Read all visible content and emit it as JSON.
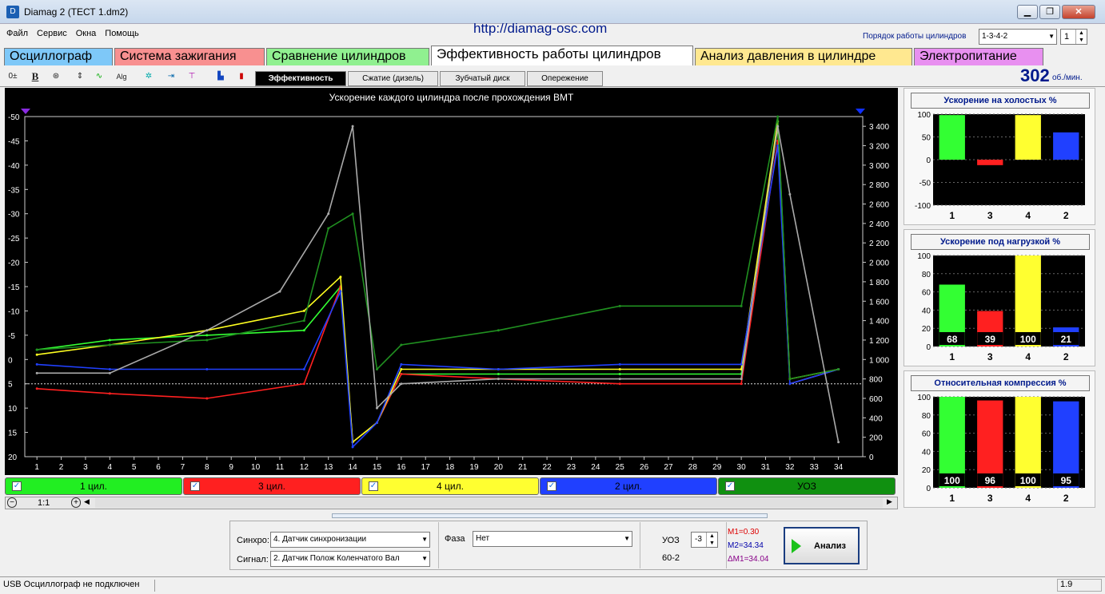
{
  "window": {
    "title": "Diamag 2 (ТЕСТ 1.dm2)",
    "url": "http://diamag-osc.com"
  },
  "menu": [
    "Файл",
    "Сервис",
    "Окна",
    "Помощь"
  ],
  "firing_order": {
    "label": "Порядок работы цилиндров",
    "value": "1-3-4-2",
    "spin": "1"
  },
  "tabs": [
    {
      "label": "Осциллограф",
      "color": "#7ec8f8"
    },
    {
      "label": "Система зажигания",
      "color": "#f89090"
    },
    {
      "label": "Сравнение цилиндров",
      "color": "#90f090"
    },
    {
      "label": "Эффективность работы цилиндров",
      "color": "#ffffff",
      "active": true
    },
    {
      "label": "Анализ давления в цилиндре",
      "color": "#ffe890"
    },
    {
      "label": "Электропитание",
      "color": "#e890f0"
    }
  ],
  "subtabs": [
    {
      "label": "Эффективность",
      "active": true
    },
    {
      "label": "Сжатие (дизель)"
    },
    {
      "label": "Зубчатый диск"
    },
    {
      "label": "Опережение"
    }
  ],
  "rpm": {
    "value": "302",
    "unit": "об./мин."
  },
  "chart_data": {
    "type": "line",
    "title": "Ускорение каждого цилиндра после прохождения ВМТ",
    "x_ticks": [
      "1",
      "2",
      "3",
      "4",
      "5",
      "6",
      "7",
      "8",
      "9",
      "10",
      "11",
      "12",
      "13",
      "14",
      "15",
      "16",
      "17",
      "18",
      "19",
      "20",
      "21",
      "22",
      "23",
      "24",
      "25",
      "26",
      "27",
      "28",
      "29",
      "30",
      "31",
      "32",
      "33",
      "34"
    ],
    "left_ticks": [
      "-50",
      "-45",
      "-40",
      "-35",
      "-30",
      "-25",
      "-20",
      "-15",
      "-10",
      "-5",
      "0",
      "5",
      "10",
      "15",
      "20"
    ],
    "right_ticks": [
      "3 400",
      "3 200",
      "3 000",
      "2 800",
      "2 600",
      "2 400",
      "2 200",
      "2 000",
      "1 800",
      "1 600",
      "1 400",
      "1 200",
      "1 000",
      "800",
      "600",
      "400",
      "200",
      "0"
    ],
    "ylim_left": [
      -50,
      20
    ],
    "ylim_right": [
      0,
      3500
    ],
    "series": [
      {
        "name": "1 цил.",
        "color": "#33ff33",
        "x": [
          1,
          4,
          8,
          12,
          13.5,
          14,
          15,
          16,
          20,
          25,
          30,
          31.5,
          32,
          34
        ],
        "y": [
          -2,
          -4,
          -5,
          -6,
          -15,
          17,
          13,
          3,
          3,
          3,
          3,
          -48,
          5,
          2
        ]
      },
      {
        "name": "3 цил.",
        "color": "#ff2020",
        "x": [
          1,
          4,
          8,
          12,
          13.5,
          14,
          15,
          16,
          20,
          25,
          30,
          31.5,
          32,
          34
        ],
        "y": [
          6,
          7,
          8,
          5,
          -15,
          17,
          13,
          3,
          4,
          5,
          5,
          -45,
          5,
          2
        ]
      },
      {
        "name": "4 цил.",
        "color": "#ffff20",
        "x": [
          1,
          4,
          8,
          12,
          13.5,
          14,
          15,
          16,
          20,
          25,
          30,
          31.5,
          32,
          34
        ],
        "y": [
          -1,
          -3,
          -6,
          -10,
          -17,
          17,
          13,
          2,
          2,
          2,
          2,
          -49,
          4,
          2
        ]
      },
      {
        "name": "2 цил.",
        "color": "#2040ff",
        "x": [
          1,
          4,
          8,
          12,
          13.5,
          14,
          15,
          16,
          20,
          25,
          30,
          31.5,
          32,
          34
        ],
        "y": [
          1,
          2,
          2,
          2,
          -14,
          18,
          13,
          1,
          2,
          1,
          1,
          -44,
          5,
          2
        ]
      },
      {
        "name": "УОЗ",
        "color": "#209020",
        "x": [
          1,
          4,
          8,
          12,
          13,
          14,
          15,
          16,
          20,
          25,
          30,
          31.5,
          32,
          34
        ],
        "y": [
          -2,
          -3,
          -4,
          -8,
          -27,
          -30,
          2,
          -3,
          -6,
          -11,
          -11,
          -50,
          4,
          2
        ]
      },
      {
        "name": "об./мин.",
        "color": "#aaaaaa",
        "axis": "right",
        "x": [
          1,
          4,
          8,
          11,
          13,
          14,
          15,
          16,
          20,
          25,
          30,
          31.5,
          32,
          34
        ],
        "y": [
          860,
          860,
          1300,
          1700,
          2500,
          3400,
          500,
          750,
          800,
          800,
          800,
          3400,
          2700,
          150
        ]
      }
    ]
  },
  "legend": [
    {
      "label": "1 цил.",
      "color": "#22ee22"
    },
    {
      "label": "3 цил.",
      "color": "#ff2020"
    },
    {
      "label": "4 цил.",
      "color": "#ffff30"
    },
    {
      "label": "2 цил.",
      "color": "#2040ff"
    },
    {
      "label": "УОЗ",
      "color": "#109010"
    }
  ],
  "zoom": {
    "ratio": "1:1"
  },
  "side_charts": [
    {
      "title": "Ускорение на холостых %",
      "yticks": [
        "100",
        "50",
        "0",
        "-50",
        "-100"
      ],
      "ymin": -100,
      "ymax": 100,
      "categories": [
        "1",
        "3",
        "4",
        "2"
      ],
      "values": [
        98,
        -12,
        98,
        60
      ],
      "labels": []
    },
    {
      "title": "Ускорение под нагрузкой %",
      "yticks": [
        "100",
        "80",
        "60",
        "40",
        "20",
        "0"
      ],
      "ymin": 0,
      "ymax": 100,
      "categories": [
        "1",
        "3",
        "4",
        "2"
      ],
      "values": [
        68,
        39,
        100,
        21
      ],
      "labels": [
        "68",
        "39",
        "100",
        "21"
      ]
    },
    {
      "title": "Относительная компрессия %",
      "yticks": [
        "100",
        "80",
        "60",
        "40",
        "20",
        "0"
      ],
      "ymin": 0,
      "ymax": 100,
      "categories": [
        "1",
        "3",
        "4",
        "2"
      ],
      "values": [
        100,
        96,
        100,
        95
      ],
      "labels": [
        "100",
        "96",
        "100",
        "95"
      ]
    }
  ],
  "bar_colors": [
    "#33ff33",
    "#ff2020",
    "#ffff30",
    "#2040ff"
  ],
  "bottom": {
    "sync_label": "Синхро:",
    "sync_value": "4.  Датчик синхронизации",
    "signal_label": "Сигнал:",
    "signal_value": "2.  Датчик Полож Коленчатого Вал",
    "phase_label": "Фаза",
    "phase_value": "Нет",
    "uoz_label": "УОЗ",
    "uoz_value": "-3",
    "wheel": "60-2",
    "m1": "M1=0.30",
    "m2": "M2=34.34",
    "dm": "ΔM1=34.04",
    "analyze": "Анализ"
  },
  "status": {
    "text": "USB Осциллограф не подключен",
    "version": "1.9"
  }
}
